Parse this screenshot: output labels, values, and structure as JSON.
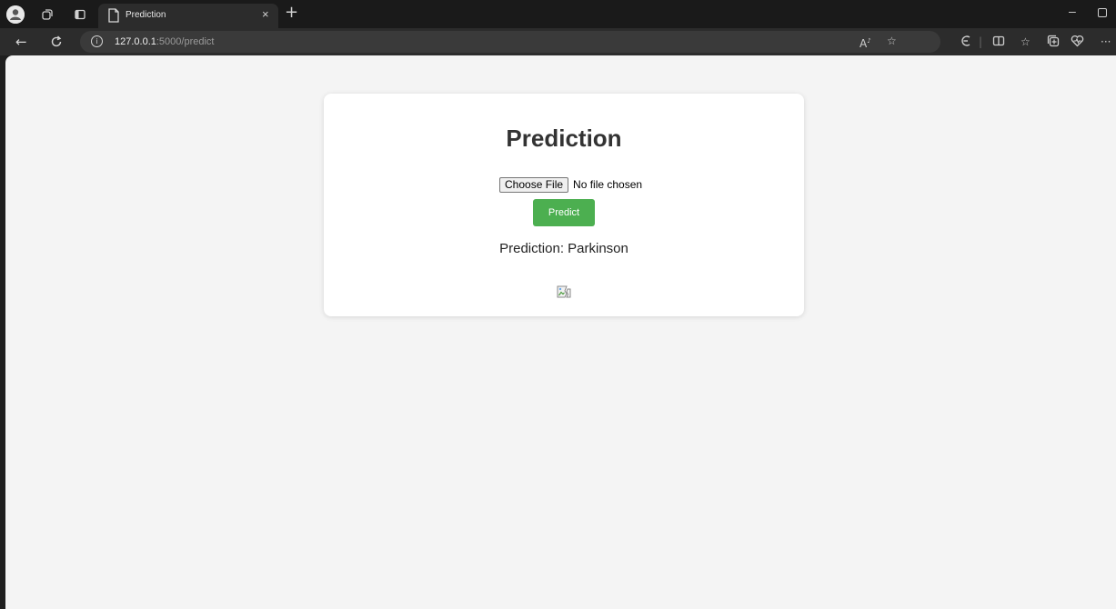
{
  "browser": {
    "tab_title": "Prediction",
    "tab_close": "×",
    "new_tab": "+",
    "url_host": "127.0.0.1",
    "url_path": ":5000/predict"
  },
  "page": {
    "title": "Prediction",
    "choose_file_label": "Choose File",
    "file_status": "No file chosen",
    "predict_button": "Predict",
    "prediction_text": "Prediction: Parkinson"
  },
  "colors": {
    "accent_button": "#4caf50",
    "page_background": "#f4f4f4",
    "card_background": "#ffffff",
    "browser_chrome": "#1f1f1f"
  },
  "icons": [
    "profile-icon",
    "workspaces-icon",
    "tab-actions-icon",
    "page-icon",
    "close-icon",
    "plus-icon",
    "back-icon",
    "refresh-icon",
    "info-icon",
    "read-aloud-icon",
    "favorite-star-icon",
    "copilot-icon",
    "split-screen-icon",
    "favorites-icon",
    "collections-icon",
    "browser-essentials-icon",
    "more-icon",
    "minimize-icon",
    "restore-icon",
    "broken-image-icon"
  ]
}
